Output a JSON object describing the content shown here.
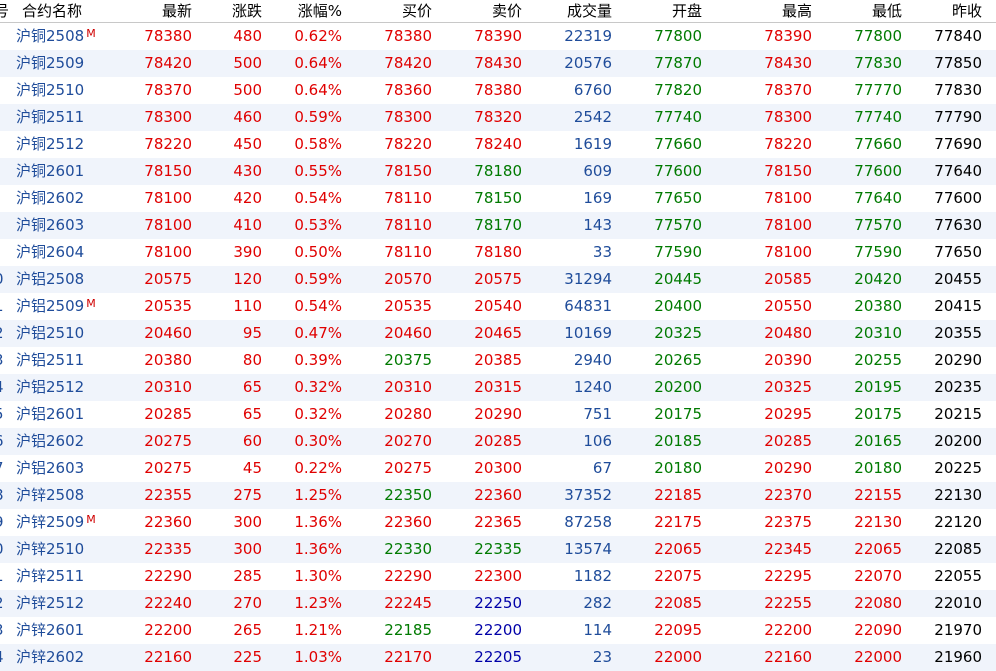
{
  "columns": {
    "idx": "号",
    "name": "合约名称",
    "last": "最新",
    "change": "涨跌",
    "change_pct": "涨幅%",
    "bid": "买价",
    "ask": "卖价",
    "volume": "成交量",
    "open": "开盘",
    "high": "最高",
    "low": "最低",
    "prev_close": "昨收"
  },
  "colors": {
    "up": "#e00000",
    "down": "#007a00",
    "flat": "#000000",
    "name": "#1f4c9a",
    "volume": "#1f4c9a",
    "navy": "#0000a8"
  },
  "rows": [
    {
      "idx": "",
      "name": "沪铜2508",
      "main": "M",
      "last": "78380",
      "change": "480",
      "pct": "0.62%",
      "bid": "78380",
      "ask": "78390",
      "vol": "22319",
      "open": "77800",
      "high": "78390",
      "low": "77800",
      "prev": "77840",
      "c_bid": "red",
      "c_ask": "red",
      "c_open": "green",
      "c_high": "red",
      "c_low": "green"
    },
    {
      "idx": "",
      "name": "沪铜2509",
      "main": "",
      "last": "78420",
      "change": "500",
      "pct": "0.64%",
      "bid": "78420",
      "ask": "78430",
      "vol": "20576",
      "open": "77870",
      "high": "78430",
      "low": "77830",
      "prev": "77850",
      "c_bid": "red",
      "c_ask": "red",
      "c_open": "green",
      "c_high": "red",
      "c_low": "green"
    },
    {
      "idx": "",
      "name": "沪铜2510",
      "main": "",
      "last": "78370",
      "change": "500",
      "pct": "0.64%",
      "bid": "78360",
      "ask": "78380",
      "vol": "6760",
      "open": "77820",
      "high": "78370",
      "low": "77770",
      "prev": "77830",
      "c_bid": "red",
      "c_ask": "red",
      "c_open": "green",
      "c_high": "red",
      "c_low": "green"
    },
    {
      "idx": "",
      "name": "沪铜2511",
      "main": "",
      "last": "78300",
      "change": "460",
      "pct": "0.59%",
      "bid": "78300",
      "ask": "78320",
      "vol": "2542",
      "open": "77740",
      "high": "78300",
      "low": "77740",
      "prev": "77790",
      "c_bid": "red",
      "c_ask": "red",
      "c_open": "green",
      "c_high": "red",
      "c_low": "green"
    },
    {
      "idx": "",
      "name": "沪铜2512",
      "main": "",
      "last": "78220",
      "change": "450",
      "pct": "0.58%",
      "bid": "78220",
      "ask": "78240",
      "vol": "1619",
      "open": "77660",
      "high": "78220",
      "low": "77660",
      "prev": "77690",
      "c_bid": "red",
      "c_ask": "red",
      "c_open": "green",
      "c_high": "red",
      "c_low": "green"
    },
    {
      "idx": "",
      "name": "沪铜2601",
      "main": "",
      "last": "78150",
      "change": "430",
      "pct": "0.55%",
      "bid": "78150",
      "ask": "78180",
      "vol": "609",
      "open": "77600",
      "high": "78150",
      "low": "77600",
      "prev": "77640",
      "c_bid": "red",
      "c_ask": "green",
      "c_open": "green",
      "c_high": "red",
      "c_low": "green"
    },
    {
      "idx": "",
      "name": "沪铜2602",
      "main": "",
      "last": "78100",
      "change": "420",
      "pct": "0.54%",
      "bid": "78110",
      "ask": "78150",
      "vol": "169",
      "open": "77650",
      "high": "78100",
      "low": "77640",
      "prev": "77600",
      "c_bid": "red",
      "c_ask": "green",
      "c_open": "green",
      "c_high": "red",
      "c_low": "green"
    },
    {
      "idx": "",
      "name": "沪铜2603",
      "main": "",
      "last": "78100",
      "change": "410",
      "pct": "0.53%",
      "bid": "78110",
      "ask": "78170",
      "vol": "143",
      "open": "77570",
      "high": "78100",
      "low": "77570",
      "prev": "77630",
      "c_bid": "red",
      "c_ask": "green",
      "c_open": "green",
      "c_high": "red",
      "c_low": "green"
    },
    {
      "idx": "",
      "name": "沪铜2604",
      "main": "",
      "last": "78100",
      "change": "390",
      "pct": "0.50%",
      "bid": "78110",
      "ask": "78180",
      "vol": "33",
      "open": "77590",
      "high": "78100",
      "low": "77590",
      "prev": "77650",
      "c_bid": "red",
      "c_ask": "red",
      "c_open": "green",
      "c_high": "red",
      "c_low": "green"
    },
    {
      "idx": "0",
      "name": "沪铝2508",
      "main": "",
      "last": "20575",
      "change": "120",
      "pct": "0.59%",
      "bid": "20570",
      "ask": "20575",
      "vol": "31294",
      "open": "20445",
      "high": "20585",
      "low": "20420",
      "prev": "20455",
      "c_bid": "red",
      "c_ask": "red",
      "c_open": "green",
      "c_high": "red",
      "c_low": "green"
    },
    {
      "idx": "1",
      "name": "沪铝2509",
      "main": "M",
      "last": "20535",
      "change": "110",
      "pct": "0.54%",
      "bid": "20535",
      "ask": "20540",
      "vol": "64831",
      "open": "20400",
      "high": "20550",
      "low": "20380",
      "prev": "20415",
      "c_bid": "red",
      "c_ask": "red",
      "c_open": "green",
      "c_high": "red",
      "c_low": "green"
    },
    {
      "idx": "2",
      "name": "沪铝2510",
      "main": "",
      "last": "20460",
      "change": "95",
      "pct": "0.47%",
      "bid": "20460",
      "ask": "20465",
      "vol": "10169",
      "open": "20325",
      "high": "20480",
      "low": "20310",
      "prev": "20355",
      "c_bid": "red",
      "c_ask": "red",
      "c_open": "green",
      "c_high": "red",
      "c_low": "green"
    },
    {
      "idx": "3",
      "name": "沪铝2511",
      "main": "",
      "last": "20380",
      "change": "80",
      "pct": "0.39%",
      "bid": "20375",
      "ask": "20385",
      "vol": "2940",
      "open": "20265",
      "high": "20390",
      "low": "20255",
      "prev": "20290",
      "c_bid": "green",
      "c_ask": "red",
      "c_open": "green",
      "c_high": "red",
      "c_low": "green"
    },
    {
      "idx": "4",
      "name": "沪铝2512",
      "main": "",
      "last": "20310",
      "change": "65",
      "pct": "0.32%",
      "bid": "20310",
      "ask": "20315",
      "vol": "1240",
      "open": "20200",
      "high": "20325",
      "low": "20195",
      "prev": "20235",
      "c_bid": "red",
      "c_ask": "red",
      "c_open": "green",
      "c_high": "red",
      "c_low": "green"
    },
    {
      "idx": "5",
      "name": "沪铝2601",
      "main": "",
      "last": "20285",
      "change": "65",
      "pct": "0.32%",
      "bid": "20280",
      "ask": "20290",
      "vol": "751",
      "open": "20175",
      "high": "20295",
      "low": "20175",
      "prev": "20215",
      "c_bid": "red",
      "c_ask": "red",
      "c_open": "green",
      "c_high": "red",
      "c_low": "green"
    },
    {
      "idx": "6",
      "name": "沪铝2602",
      "main": "",
      "last": "20275",
      "change": "60",
      "pct": "0.30%",
      "bid": "20270",
      "ask": "20285",
      "vol": "106",
      "open": "20185",
      "high": "20285",
      "low": "20165",
      "prev": "20200",
      "c_bid": "red",
      "c_ask": "red",
      "c_open": "green",
      "c_high": "red",
      "c_low": "green"
    },
    {
      "idx": "7",
      "name": "沪铝2603",
      "main": "",
      "last": "20275",
      "change": "45",
      "pct": "0.22%",
      "bid": "20275",
      "ask": "20300",
      "vol": "67",
      "open": "20180",
      "high": "20290",
      "low": "20180",
      "prev": "20225",
      "c_bid": "red",
      "c_ask": "red",
      "c_open": "green",
      "c_high": "red",
      "c_low": "green"
    },
    {
      "idx": "8",
      "name": "沪锌2508",
      "main": "",
      "last": "22355",
      "change": "275",
      "pct": "1.25%",
      "bid": "22350",
      "ask": "22360",
      "vol": "37352",
      "open": "22185",
      "high": "22370",
      "low": "22155",
      "prev": "22130",
      "c_bid": "green",
      "c_ask": "red",
      "c_open": "red",
      "c_high": "red",
      "c_low": "red"
    },
    {
      "idx": "9",
      "name": "沪锌2509",
      "main": "M",
      "last": "22360",
      "change": "300",
      "pct": "1.36%",
      "bid": "22360",
      "ask": "22365",
      "vol": "87258",
      "open": "22175",
      "high": "22375",
      "low": "22130",
      "prev": "22120",
      "c_bid": "red",
      "c_ask": "red",
      "c_open": "red",
      "c_high": "red",
      "c_low": "red"
    },
    {
      "idx": "0",
      "name": "沪锌2510",
      "main": "",
      "last": "22335",
      "change": "300",
      "pct": "1.36%",
      "bid": "22330",
      "ask": "22335",
      "vol": "13574",
      "open": "22065",
      "high": "22345",
      "low": "22065",
      "prev": "22085",
      "c_bid": "green",
      "c_ask": "green",
      "c_open": "red",
      "c_high": "red",
      "c_low": "red"
    },
    {
      "idx": "1",
      "name": "沪锌2511",
      "main": "",
      "last": "22290",
      "change": "285",
      "pct": "1.30%",
      "bid": "22290",
      "ask": "22300",
      "vol": "1182",
      "open": "22075",
      "high": "22295",
      "low": "22070",
      "prev": "22055",
      "c_bid": "red",
      "c_ask": "red",
      "c_open": "red",
      "c_high": "red",
      "c_low": "red"
    },
    {
      "idx": "2",
      "name": "沪锌2512",
      "main": "",
      "last": "22240",
      "change": "270",
      "pct": "1.23%",
      "bid": "22245",
      "ask": "22250",
      "vol": "282",
      "open": "22085",
      "high": "22255",
      "low": "22080",
      "prev": "22010",
      "c_bid": "red",
      "c_ask": "navy",
      "c_open": "red",
      "c_high": "red",
      "c_low": "red"
    },
    {
      "idx": "3",
      "name": "沪锌2601",
      "main": "",
      "last": "22200",
      "change": "265",
      "pct": "1.21%",
      "bid": "22185",
      "ask": "22200",
      "vol": "114",
      "open": "22095",
      "high": "22200",
      "low": "22090",
      "prev": "21970",
      "c_bid": "green",
      "c_ask": "navy",
      "c_open": "red",
      "c_high": "red",
      "c_low": "red"
    },
    {
      "idx": "4",
      "name": "沪锌2602",
      "main": "",
      "last": "22160",
      "change": "225",
      "pct": "1.03%",
      "bid": "22170",
      "ask": "22205",
      "vol": "23",
      "open": "22000",
      "high": "22160",
      "low": "22000",
      "prev": "21960",
      "c_bid": "red",
      "c_ask": "navy",
      "c_open": "red",
      "c_high": "red",
      "c_low": "red"
    }
  ]
}
